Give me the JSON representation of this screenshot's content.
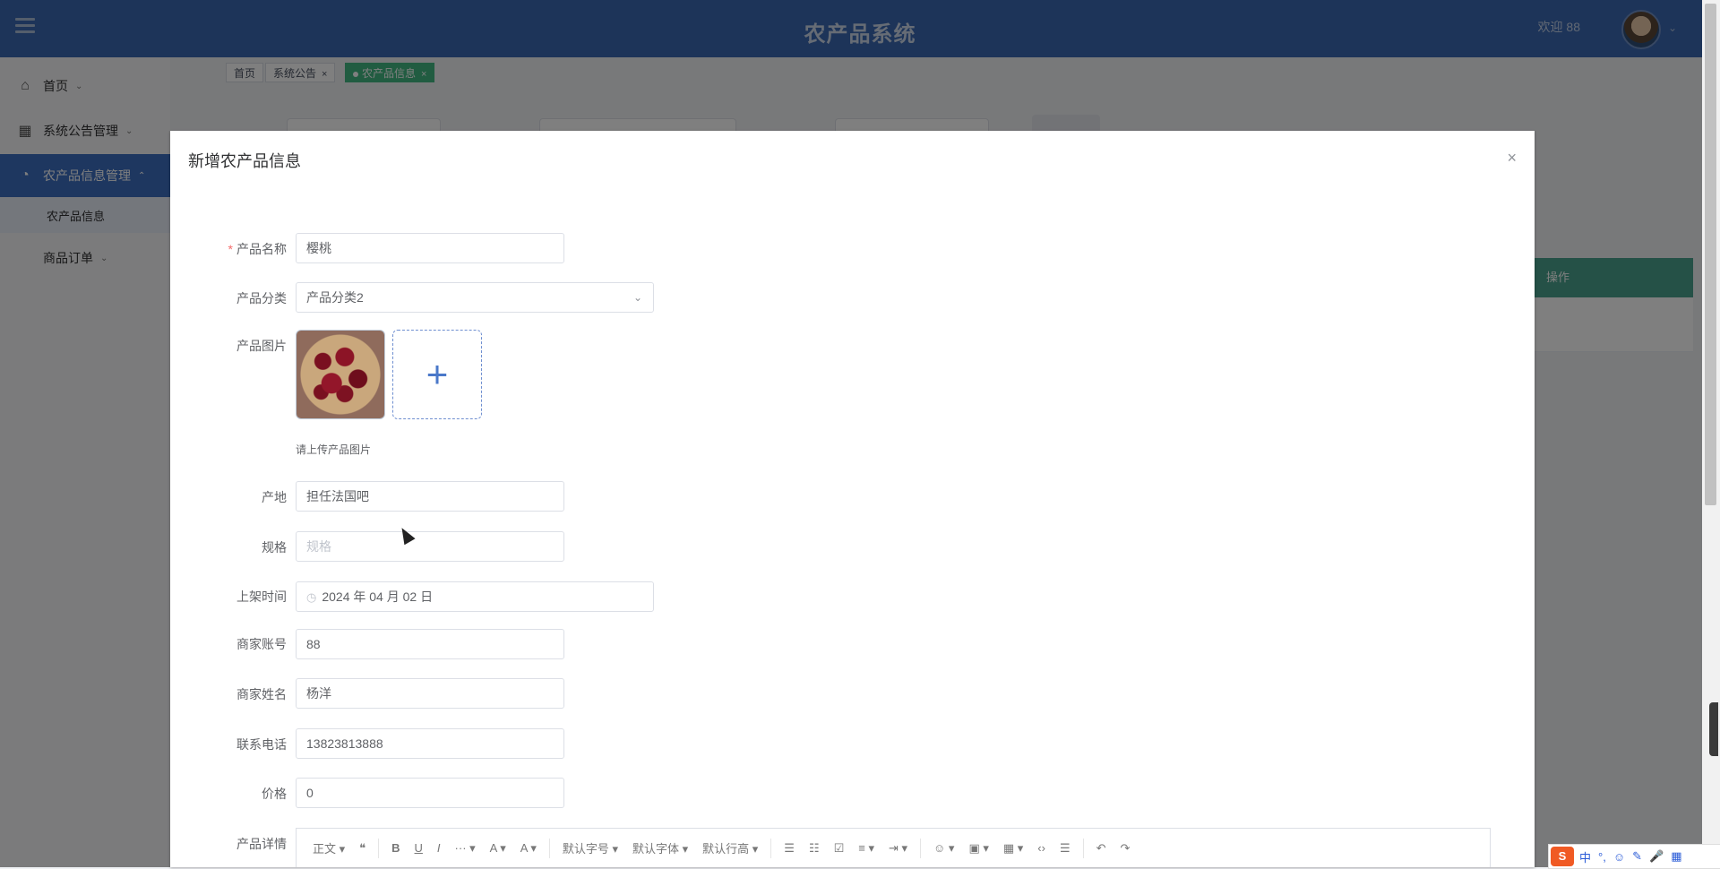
{
  "header": {
    "title": "农产品系统",
    "welcome": "欢迎 88",
    "caret": "⌄"
  },
  "sidebar": {
    "items": [
      {
        "label": "首页",
        "icon": "home-icon",
        "caret": "⌄"
      },
      {
        "label": "系统公告管理",
        "icon": "grid-icon",
        "caret": "⌄"
      },
      {
        "label": "农产品信息管理",
        "icon": "pie-icon",
        "caret": "⌃"
      },
      {
        "label": "商品订单",
        "icon": "",
        "caret": "⌄"
      }
    ],
    "subitems": [
      {
        "label": "农产品信息"
      }
    ]
  },
  "tabs": [
    {
      "label": "首页"
    },
    {
      "label": "系统公告",
      "close": "×"
    },
    {
      "label": "农产品信息",
      "close": "×"
    }
  ],
  "background_page": {
    "table_header": "操作"
  },
  "dialog": {
    "title": "新增农产品信息",
    "close": "×",
    "fields": {
      "name": {
        "label": "产品名称",
        "required": "*",
        "value": "樱桃"
      },
      "category": {
        "label": "产品分类",
        "value": "产品分类2",
        "chevron": "⌄"
      },
      "image": {
        "label": "产品图片",
        "upload_plus": "+",
        "tip": "请上传产品图片"
      },
      "origin": {
        "label": "产地",
        "value": "担任法国吧"
      },
      "spec": {
        "label": "规格",
        "placeholder": "规格"
      },
      "listing_time": {
        "label": "上架时间",
        "value": "2024 年 04 月 02 日",
        "icon": "◷"
      },
      "merchant_account": {
        "label": "商家账号",
        "value": "88"
      },
      "merchant_name": {
        "label": "商家姓名",
        "value": "杨洋"
      },
      "phone": {
        "label": "联系电话",
        "value": "13823813888"
      },
      "price": {
        "label": "价格",
        "value": "0"
      },
      "detail": {
        "label": "产品详情"
      }
    },
    "editor_toolbar": {
      "paragraph": "正文 ▾",
      "quote": "❝",
      "bold": "B",
      "underline": "U",
      "italic": "I",
      "more": "··· ▾",
      "font_color": "A ▾",
      "bg_color": "A ▾",
      "font_size": "默认字号 ▾",
      "font_family": "默认字体 ▾",
      "line_height": "默认行高 ▾",
      "bullet_list": "☰",
      "numbered_list": "☷",
      "todo": "☑",
      "align": "≡ ▾",
      "indent": "⇥ ▾",
      "emoji": "☺ ▾",
      "image": "▣ ▾",
      "table": "▦ ▾",
      "code": "‹›",
      "divider": "☰",
      "undo": "↶",
      "redo": "↷"
    }
  },
  "ime": {
    "logo": "S",
    "items": [
      "中",
      "°,",
      "☺",
      "✎",
      "🎤",
      "▦"
    ]
  }
}
